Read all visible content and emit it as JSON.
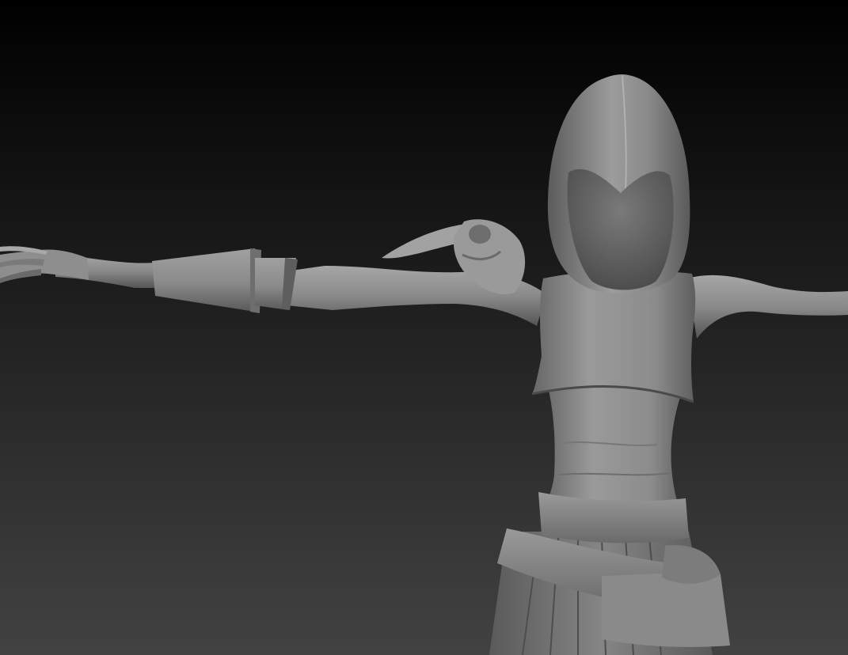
{
  "viewport": {
    "label": "",
    "background_top": "#000000",
    "background_bottom": "#424242",
    "model_material": "#8e8e8e",
    "model_shadow": "#4a4a4a",
    "model_highlight": "#b4b4b4"
  },
  "model": {
    "parts": [
      "hood",
      "face-opening",
      "skull-mask",
      "left-arm",
      "right-arm",
      "hand",
      "bracer",
      "crop-top",
      "torso",
      "belt",
      "skirt"
    ]
  }
}
